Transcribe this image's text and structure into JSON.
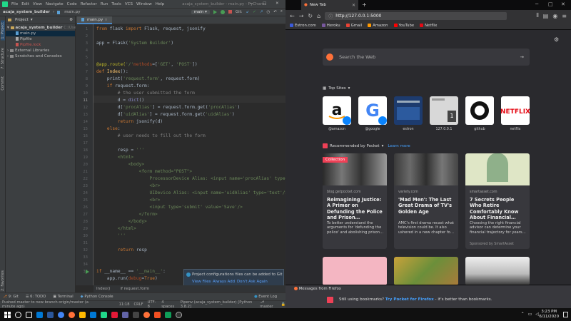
{
  "pycharm": {
    "menu": [
      "File",
      "Edit",
      "View",
      "Navigate",
      "Code",
      "Refactor",
      "Run",
      "Tools",
      "VCS",
      "Window",
      "Help"
    ],
    "window_title": "acaja_system_builder - main.py - PyCharm",
    "nav": {
      "project": "acaja_system_builder",
      "file": "main.py"
    },
    "run_config": "main",
    "git_label": "Git:",
    "left_strip": {
      "project": "1: Project",
      "structure": "7: Structure",
      "commit": "Commit",
      "favorites": "2: Favorites"
    },
    "project_panel": {
      "header": "Project",
      "items": [
        {
          "text": "acaja_system_builder",
          "suffix": "C:\\Users\\gust"
        },
        {
          "text": "main.py"
        },
        {
          "text": "Pipfile"
        },
        {
          "text": "Pipfile.lock"
        },
        {
          "text": "External Libraries"
        },
        {
          "text": "Scratches and Consoles"
        }
      ]
    },
    "editor_tab": "main.py",
    "line_numbers": [
      "1",
      "2",
      "3",
      "4",
      "5",
      "6",
      "7",
      "8",
      "9",
      "10",
      "11",
      "12",
      "13",
      "14",
      "15",
      "16",
      "17",
      "18",
      "19",
      "20",
      "21",
      "22",
      "23",
      "24",
      "25",
      "26",
      "27",
      "28",
      "29",
      "30",
      "31",
      "32",
      "33",
      "34",
      "35"
    ],
    "code": {
      "l1a": "from",
      "l1b": " flask ",
      "l1c": "import",
      "l1d": " Flask, request, jsonify",
      "l3a": "app = Flask(",
      "l3b": "'System Builder'",
      "l3c": ")",
      "l6a": "@app.route(",
      "l6b": "'/'",
      ",l6c": "",
      "l6d": "methods",
      "l6e": "=[",
      "l6f": "'GET'",
      "l6g": ", ",
      "l6h": "'POST'",
      "l6i": "])",
      "l7a": "def ",
      "l7b": "Index",
      "l7c": "():",
      "l8a": "    print(",
      "l8b": "'request.form'",
      "l8c": ", request.form)",
      "l9a": "    if ",
      "l9b": "request.form:",
      "l10": "        # the user submitted the form",
      "l11a": "        d = ",
      "l11b": "dict",
      "l11c": "()",
      "l12a": "        d[",
      "l12b": "'procAlias'",
      "l12c": "] = request.form.get(",
      "l12d": "'procAlias'",
      "l12e": ")",
      "l13a": "        d[",
      "l13b": "'uidAlias'",
      "l13c": "] = request.form.get(",
      "l13d": "'uidAlias'",
      "l13e": ")",
      "l14a": "        return ",
      "l14b": "jsonify(d)",
      "l15a": "    else",
      "l15b": ":",
      "l16": "        # user needs to fill out the form",
      "l18a": "        resp = ",
      "l18b": "'''",
      "l19": "        <html>",
      "l20": "            <body>",
      "l21a": "                <form ",
      "l21b": "method=\"POST\"",
      "l21c": ">",
      "l22a": "                    ProcessorDevice Alias: <input ",
      "l22b": "name='procAlias' type='text'",
      "l22c": "/>",
      "l23": "                    <br>",
      "l24a": "                    UIDevice Alias: <input ",
      "l24b": "name='uidAlias' type='text'",
      "l24c": "/>",
      "l25": "                    <br>",
      "l26a": "                    <input ",
      "l26b": "type='submit' value='Save'",
      "l26c": "/>",
      "l27": "                </form>",
      "l28": "            </body>",
      "l29": "        </html>",
      "l30": "        '''",
      "l32a": "        return ",
      "l32b": "resp",
      "l35a": "if ",
      "l35b": "__name__",
      " l35c": "",
      "l35d": " == ",
      "l35e": "'__main__'",
      "l35f": ":",
      "l36a": "    app.run(",
      "l36b": "debug",
      "l36c": "=",
      "l36d": "True",
      ")": "",
      "l36e": ")"
    },
    "breadcrumbs": [
      "Index()",
      "if request.form"
    ],
    "tool_windows": [
      "9: Git",
      "6: TODO",
      "Terminal",
      "Python Console",
      "Event Log"
    ],
    "status": {
      "message": "Pushed master to new branch origin/master (a minute ago)",
      "position": "11:18",
      "line_sep": "CRLF",
      "encoding": "UTF-8",
      "indent": "4 spaces",
      "interpreter": "Pipenv (acaja_system_builder) [Python 3.8.2]",
      "branch": "master"
    },
    "notification": {
      "text": "Project configurations files can be added to Git",
      "actions": [
        "View Files",
        "Always Add",
        "Don't Ask Again"
      ],
      "more": "1 more"
    }
  },
  "firefox": {
    "tab_title": "New Tab",
    "url": "http://127.0.0.1:5000",
    "bookmarks": [
      "Estron.com",
      "Heroku",
      "Gmail",
      "Amazon",
      "YouTube",
      "Netflix"
    ],
    "search_placeholder": "Search the Web",
    "top_sites_label": "Top Sites",
    "top_sites": [
      {
        "label": "@amazon"
      },
      {
        "label": "@google"
      },
      {
        "label": "estron"
      },
      {
        "label": "127.0.0.1"
      },
      {
        "label": "github"
      },
      {
        "label": "netflix"
      }
    ],
    "pocket_label": "Recommended by Pocket",
    "learn_more": "Learn more",
    "cards": [
      {
        "source": "blog.getpocket.com",
        "title": "Reimagining Justice: A Primer on Defunding the Police and Prison…",
        "desc": "To better understand the arguments for 'defunding the police' and abolishing prison…",
        "badge": "Collection"
      },
      {
        "source": "variety.com",
        "title": "'Mad Men': The Last Great Drama of TV's Golden Age",
        "desc": "AMC's first drama recast what television could be. It also ushered in a new chapter fo…"
      },
      {
        "source": "smartasset.com",
        "title": "7 Secrets People Who Retire Comfortably Know About Financial…",
        "desc": "Choosing the right financial advisor can determine your financial trajectory for years…",
        "sponsor": "Sponsored by SmartAsset"
      }
    ],
    "messages": {
      "header": "Messages from Firefox",
      "body_prefix": "Still using bookmarks? ",
      "link": "Try Pocket for Firefox",
      "body_suffix": " - it's better than bookmarks."
    }
  },
  "taskbar": {
    "time": "3:23 PM",
    "date": "6/11/2020"
  }
}
